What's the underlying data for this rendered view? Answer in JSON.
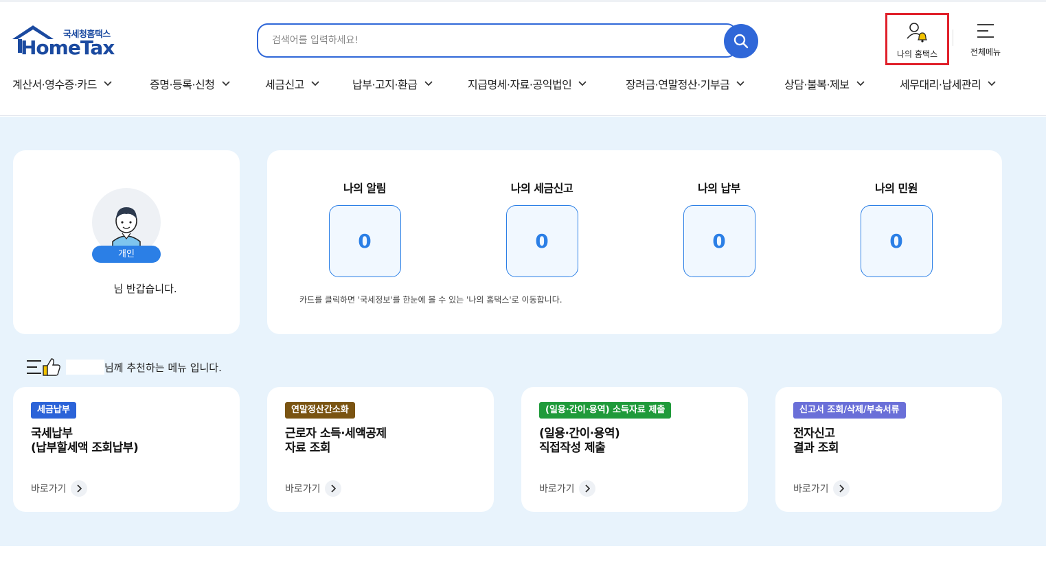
{
  "header": {
    "logo_sub": "국세청홈택스",
    "logo_main": "HomeTax",
    "search_placeholder": "검색어를 입력하세요!",
    "my_hometax": "나의 홈택스",
    "all_menu": "전체메뉴"
  },
  "nav": [
    {
      "label": "계산서·영수증·카드"
    },
    {
      "label": "증명·등록·신청"
    },
    {
      "label": "세금신고"
    },
    {
      "label": "납부·고지·환급"
    },
    {
      "label": "지급명세·자료·공익법인"
    },
    {
      "label": "장려금·연말정산·기부금"
    },
    {
      "label": "상담·불복·제보"
    },
    {
      "label": "세무대리·납세관리"
    }
  ],
  "profile": {
    "badge": "개인",
    "greeting": "님 반갑습니다."
  },
  "summary": {
    "stats": [
      {
        "title": "나의 알림",
        "value": "0"
      },
      {
        "title": "나의 세금신고",
        "value": "0"
      },
      {
        "title": "나의 납부",
        "value": "0"
      },
      {
        "title": "나의 민원",
        "value": "0"
      }
    ],
    "note": "카드를 클릭하면 '국세정보'를 한눈에 볼 수 있는 '나의 홈택스'로 이동합니다."
  },
  "recommend": {
    "title": "님께 추천하는 메뉴 입니다.",
    "go_label": "바로가기",
    "cards": [
      {
        "tag": "세금납부",
        "tag_color": "#2b63d8",
        "line1": "국세납부",
        "line2": "(납부할세액 조회납부)"
      },
      {
        "tag": "연말정산간소화",
        "tag_color": "#7a5412",
        "line1": "근로자 소득·세액공제",
        "line2": "자료 조회"
      },
      {
        "tag": "(일용·간이·용역) 소득자료 제출",
        "tag_color": "#1f9a3a",
        "line1": "(일용·간이·용역)",
        "line2": "직접작성 제출"
      },
      {
        "tag": "신고서 조회/삭제/부속서류",
        "tag_color": "#6a6fd8",
        "line1": "전자신고",
        "line2": "결과 조회"
      }
    ]
  }
}
